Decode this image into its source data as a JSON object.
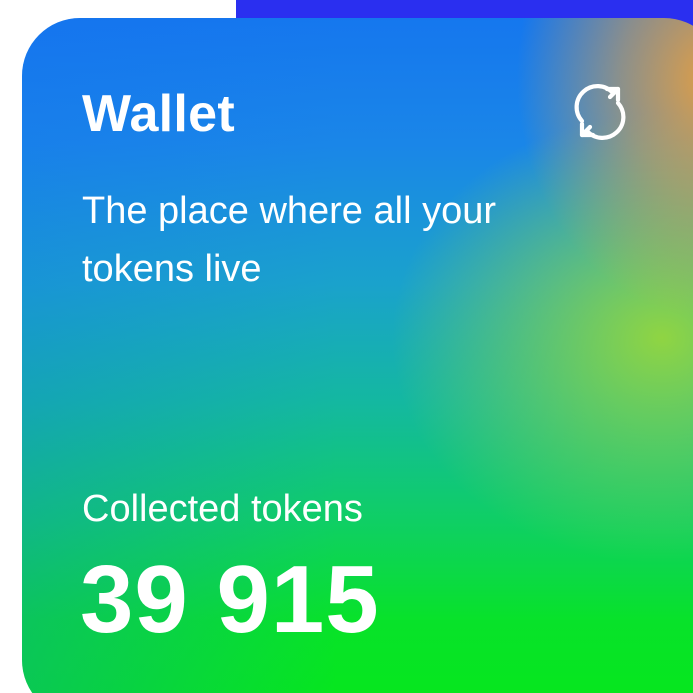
{
  "wallet_card": {
    "title": "Wallet",
    "subtitle": "The place where all your tokens live",
    "refresh_icon": "refresh-icon",
    "tokens_label": "Collected tokens",
    "tokens_value": "39 915"
  },
  "colors": {
    "accent_blue": "#2a2ff0",
    "gradient_top": "#1577ee",
    "gradient_bottom": "#05e81a",
    "gradient_corner": "#eca03c",
    "text": "#ffffff"
  }
}
